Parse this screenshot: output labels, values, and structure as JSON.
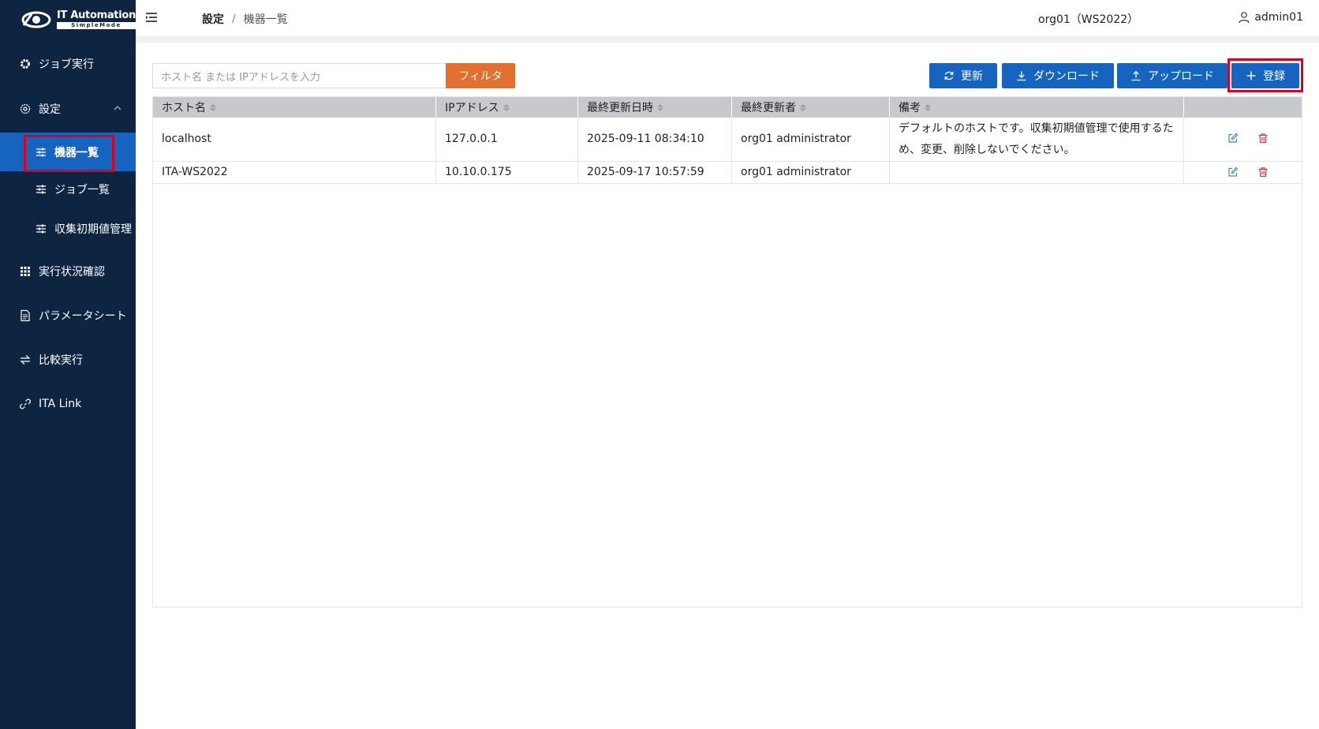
{
  "app": {
    "logo_title": "IT Automation",
    "logo_subtitle": "SimpleMode"
  },
  "sidebar": {
    "items": [
      {
        "label": "ジョブ実行",
        "icon": "gear-icon"
      },
      {
        "label": "設定",
        "icon": "settings-icon",
        "expanded": true
      },
      {
        "label": "機器一覧",
        "icon": "sliders-icon",
        "active": true
      },
      {
        "label": "ジョブ一覧",
        "icon": "sliders-icon"
      },
      {
        "label": "収集初期値管理",
        "icon": "sliders-icon"
      },
      {
        "label": "実行状況確認",
        "icon": "grid-icon"
      },
      {
        "label": "パラメータシート",
        "icon": "document-icon"
      },
      {
        "label": "比較実行",
        "icon": "compare-icon"
      },
      {
        "label": "ITA Link",
        "icon": "link-icon"
      }
    ]
  },
  "header": {
    "breadcrumb_parent": "設定",
    "breadcrumb_sep": "/",
    "breadcrumb_current": "機器一覧",
    "org": "org01（WS2022）",
    "user": "admin01"
  },
  "toolbar": {
    "search_placeholder": "ホスト名 または IPアドレスを入力",
    "filter_label": "フィルタ",
    "refresh_label": "更新",
    "download_label": "ダウンロード",
    "upload_label": "アップロード",
    "register_label": "登録"
  },
  "table": {
    "columns": [
      "ホスト名",
      "IPアドレス",
      "最終更新日時",
      "最終更新者",
      "備考",
      ""
    ],
    "rows": [
      {
        "host": "localhost",
        "ip": "127.0.0.1",
        "updated_at": "2025-09-11 08:34:10",
        "updated_by": "org01 administrator",
        "note": "デフォルトのホストです。収集初期値管理で使用するため、変更、削除しないでください。"
      },
      {
        "host": "ITA-WS2022",
        "ip": "10.10.0.175",
        "updated_at": "2025-09-17 10:57:59",
        "updated_by": "org01 administrator",
        "note": ""
      }
    ]
  },
  "colors": {
    "sidebar_bg": "#0d2541",
    "primary": "#1565c0",
    "filter": "#e36f2f",
    "highlight": "#e0001b",
    "delete": "#e0303a"
  }
}
